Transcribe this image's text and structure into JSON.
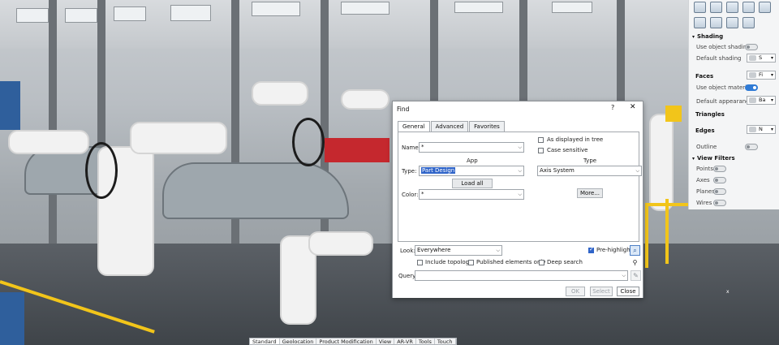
{
  "properties_panel": {
    "sections": {
      "shading": {
        "title": "Shading",
        "use_object_shading_label": "Use object shading",
        "default_shading_label": "Default shading",
        "default_shading_value": "S"
      },
      "faces": {
        "title": "Faces",
        "faces_value": "Fi",
        "use_object_material_label": "Use object material",
        "default_appearance_label": "Default appearance",
        "default_appearance_value": "Ba"
      },
      "triangles": {
        "title": "Triangles"
      },
      "edges": {
        "title": "Edges",
        "edges_value": "N",
        "outline_label": "Outline"
      },
      "view_filters": {
        "title": "View Filters",
        "points_label": "Points",
        "axes_label": "Axes",
        "planes_label": "Planes",
        "wires_label": "Wires"
      }
    },
    "toggles": {
      "use_object_shading": false,
      "use_object_material": true,
      "outline": false,
      "points": false,
      "axes": false,
      "planes": false,
      "wires": false
    }
  },
  "find_dialog": {
    "title": "Find",
    "help_glyph": "?",
    "close_glyph": "✕",
    "tabs": [
      {
        "label": "General",
        "active": true
      },
      {
        "label": "Advanced",
        "active": false
      },
      {
        "label": "Favorites",
        "active": false
      }
    ],
    "general": {
      "name_label": "Name:",
      "name_value": "*",
      "as_displayed_in_tree_label": "As displayed in tree",
      "as_displayed_in_tree_checked": false,
      "case_sensitive_label": "Case sensitive",
      "case_sensitive_checked": false,
      "app_header": "App",
      "type_header": "Type",
      "type_label": "Type:",
      "app_value": "Part Design",
      "type_value": "Axis System",
      "load_all_types_label": "Load all types",
      "color_label": "Color:",
      "color_value": "*",
      "more_button_label": "More..."
    },
    "look": {
      "label": "Look:",
      "value": "Everywhere",
      "pre_highlight_label": "Pre-highlight",
      "pre_highlight_checked": true,
      "include_topology_label": "Include topology",
      "include_topology_checked": false,
      "published_elements_only_label": "Published elements only",
      "published_elements_only_checked": false,
      "deep_search_label": "Deep search",
      "deep_search_checked": false
    },
    "query": {
      "label": "Query:",
      "value": ""
    },
    "buttons": {
      "ok": "OK",
      "select": "Select",
      "close": "Close"
    }
  },
  "bottom_tabs": [
    {
      "label": "Standard",
      "active": true
    },
    {
      "label": "Geolocation",
      "active": false
    },
    {
      "label": "Product Modification",
      "active": false
    },
    {
      "label": "View",
      "active": false
    },
    {
      "label": "AR-VR",
      "active": false
    },
    {
      "label": "Tools",
      "active": false
    },
    {
      "label": "Touch",
      "active": false
    }
  ],
  "axis_indicator": {
    "x_label": "x"
  },
  "colors": {
    "accent": "#2f64c9",
    "toggle_on": "#2f7ad5",
    "dialog_bg": "#ffffff",
    "panel_bg": "#f4f5f6"
  }
}
